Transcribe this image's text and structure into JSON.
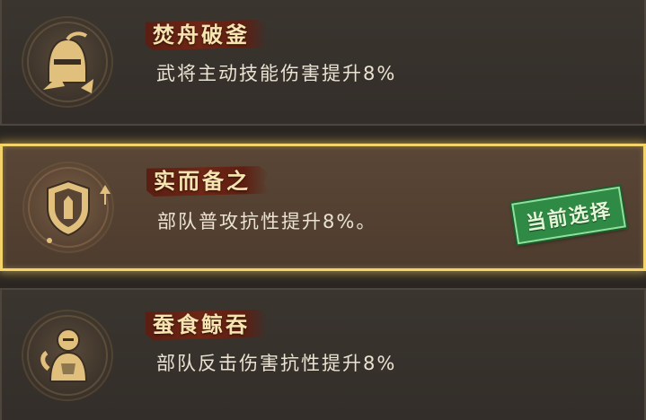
{
  "talents": [
    {
      "title": "焚舟破釜",
      "description": "武将主动技能伤害提升8%",
      "icon": "helmet-icon",
      "selected": false
    },
    {
      "title": "实而备之",
      "description": "部队普攻抗性提升8%。",
      "icon": "shield-icon",
      "selected": true
    },
    {
      "title": "蚕食鲸吞",
      "description": "部队反击伤害抗性提升8%",
      "icon": "armored-warrior-icon",
      "selected": false
    }
  ],
  "selected_badge": "当前选择",
  "colors": {
    "gold": "#e3c07a",
    "ribbon": "#6e2615",
    "highlight_border": "#f3d36a",
    "badge_green": "#2f8a45"
  }
}
